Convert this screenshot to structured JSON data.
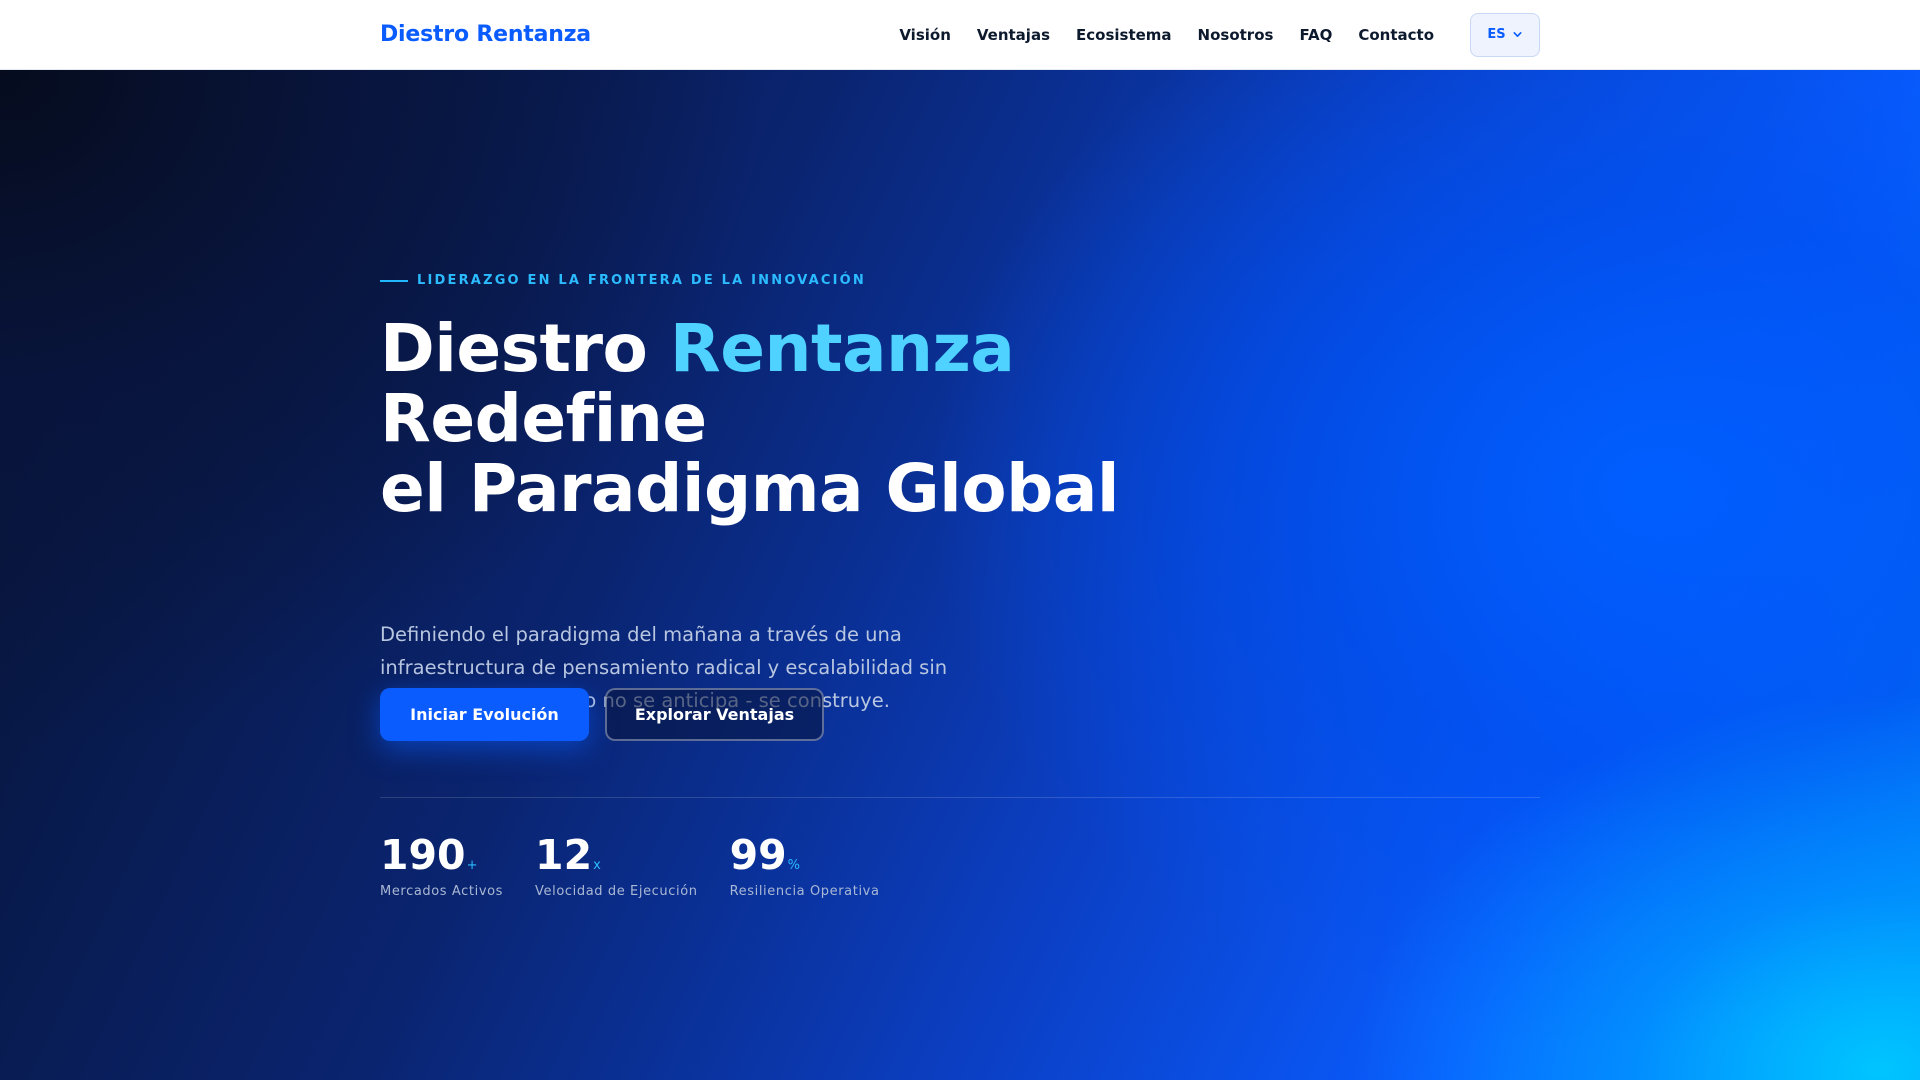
{
  "header": {
    "logo": "Diestro Rentanza",
    "nav": [
      {
        "label": "Visión"
      },
      {
        "label": "Ventajas"
      },
      {
        "label": "Ecosistema"
      },
      {
        "label": "Nosotros"
      },
      {
        "label": "FAQ"
      },
      {
        "label": "Contacto"
      }
    ],
    "language": "ES"
  },
  "hero": {
    "eyebrow": "LIDERAZGO EN LA FRONTERA DE LA INNOVACIÓN",
    "headline": {
      "line1_start": "Diestro ",
      "line1_accent": "Rentanza",
      "line2": "Redefine",
      "line3": "el Paradigma Global"
    },
    "subtitle": "Definiendo el paradigma del mañana a través de una infraestructura de pensamiento radical y escalabilidad sin precedentes. El futuro no se anticipa - se construye.",
    "primary_button": "Iniciar Evolución",
    "secondary_button": "Explorar Ventajas",
    "stats": [
      {
        "value": "190",
        "suffix": "+",
        "label": "Mercados Activos"
      },
      {
        "value": "12",
        "suffix": "x",
        "label": "Velocidad de Ejecución"
      },
      {
        "value": "99",
        "suffix": "%",
        "label": "Resiliencia Operativa"
      }
    ]
  },
  "colors": {
    "brand": "#0a5cff",
    "accent": "#4fd2ff",
    "nav_text": "#0d1a2e"
  },
  "icons": {
    "language_dropdown": "chevron-down-icon"
  }
}
